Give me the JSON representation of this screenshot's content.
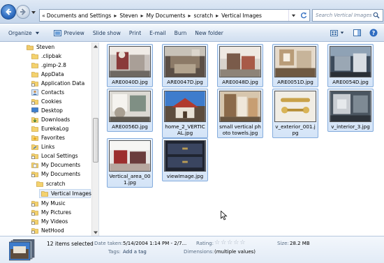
{
  "address": {
    "crumb_prefix": "«",
    "crumbs": [
      "Documents and Settings",
      "Steven",
      "My Documents",
      "scratch",
      "Vertical Images"
    ],
    "search_placeholder": "Search Vertical Images"
  },
  "toolbar": {
    "organize_label": "Organize",
    "preview_label": "Preview",
    "slideshow_label": "Slide show",
    "print_label": "Print",
    "email_label": "E-mail",
    "burn_label": "Burn",
    "newfolder_label": "New folder"
  },
  "tree": [
    {
      "label": "Steven",
      "icon": "user-folder-icon"
    },
    {
      "label": ".clipbak",
      "icon": "folder-icon"
    },
    {
      "label": ".gimp-2.8",
      "icon": "folder-icon"
    },
    {
      "label": "AppData",
      "icon": "folder-icon"
    },
    {
      "label": "Application Data",
      "icon": "shortcut-folder-icon"
    },
    {
      "label": "Contacts",
      "icon": "contacts-icon"
    },
    {
      "label": "Cookies",
      "icon": "shortcut-folder-icon"
    },
    {
      "label": "Desktop",
      "icon": "desktop-icon"
    },
    {
      "label": "Downloads",
      "icon": "downloads-icon"
    },
    {
      "label": "EurekaLog",
      "icon": "folder-icon"
    },
    {
      "label": "Favorites",
      "icon": "favorites-icon"
    },
    {
      "label": "Links",
      "icon": "links-icon"
    },
    {
      "label": "Local Settings",
      "icon": "shortcut-folder-icon"
    },
    {
      "label": "My Documents",
      "icon": "documents-icon"
    },
    {
      "label": "My Documents",
      "icon": "shortcut-folder-icon"
    },
    {
      "label": "scratch",
      "icon": "folder-icon"
    },
    {
      "label": "Vertical Images",
      "icon": "folder-icon"
    },
    {
      "label": "My Music",
      "icon": "shortcut-folder-icon"
    },
    {
      "label": "My Pictures",
      "icon": "shortcut-folder-icon"
    },
    {
      "label": "My Videos",
      "icon": "shortcut-folder-icon"
    },
    {
      "label": "NetHood",
      "icon": "shortcut-folder-icon"
    }
  ],
  "files": [
    {
      "name": "ARE0040D.jpg"
    },
    {
      "name": "ARE0047D.jpg"
    },
    {
      "name": "ARE0048D.jpg"
    },
    {
      "name": "ARE0051D.jpg"
    },
    {
      "name": "ARE0054D.jpg"
    },
    {
      "name": "ARE0056D.jpg"
    },
    {
      "name": "home_2_VERTICAL.jpg"
    },
    {
      "name": "small vertical photo towels.jpg"
    },
    {
      "name": "v_exterior_001.jpg"
    },
    {
      "name": "v_interior_3.jpg"
    },
    {
      "name": "Vertical_area_001.jpg"
    },
    {
      "name": "viewImage.jpg"
    }
  ],
  "details": {
    "count_text": "12 items selected",
    "date_key": "Date taken:",
    "date_value": "5/14/2004 1:14 PM - 2/7...",
    "tags_key": "Tags:",
    "tags_value": "Add a tag",
    "rating_key": "Rating:",
    "dimensions_key": "Dimensions:",
    "dimensions_value": "(multiple values)",
    "size_key": "Size:",
    "size_value": "28.2 MB"
  },
  "colors": {
    "accent": "#84acdd",
    "selection": "#d4e4f7",
    "toolbar_text": "#1e395b"
  }
}
